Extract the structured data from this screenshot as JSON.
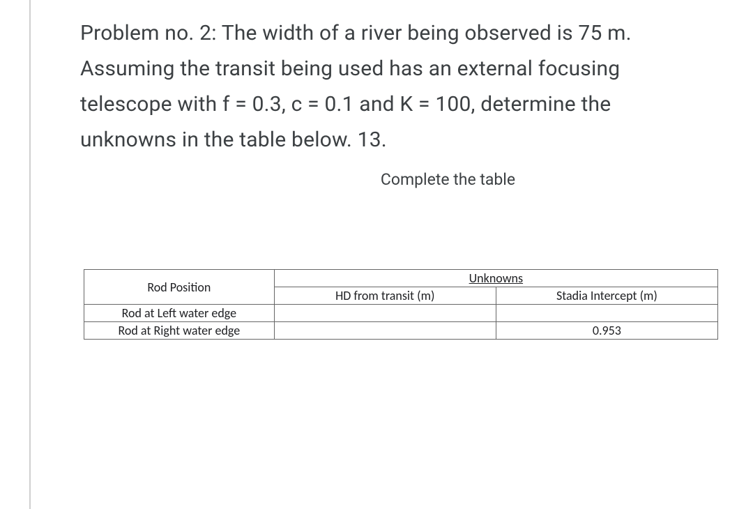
{
  "problem": {
    "text": "Problem no. 2: The width of a river being observed is 75 m. Assuming the transit being used has an external focusing telescope with f = 0.3, c = 0.1 and K = 100, determine the unknowns in the table below. 13."
  },
  "subtitle": "Complete the table",
  "table": {
    "header": {
      "rod_position": "Rod Position",
      "unknowns": "Unknowns",
      "hd_from_transit": "HD from transit (m)",
      "stadia_intercept": "Stadia Intercept (m)"
    },
    "rows": [
      {
        "position": "Rod at Left water edge",
        "hd": "",
        "stadia": ""
      },
      {
        "position": "Rod at Right water edge",
        "hd": "",
        "stadia": "0.953"
      }
    ]
  }
}
